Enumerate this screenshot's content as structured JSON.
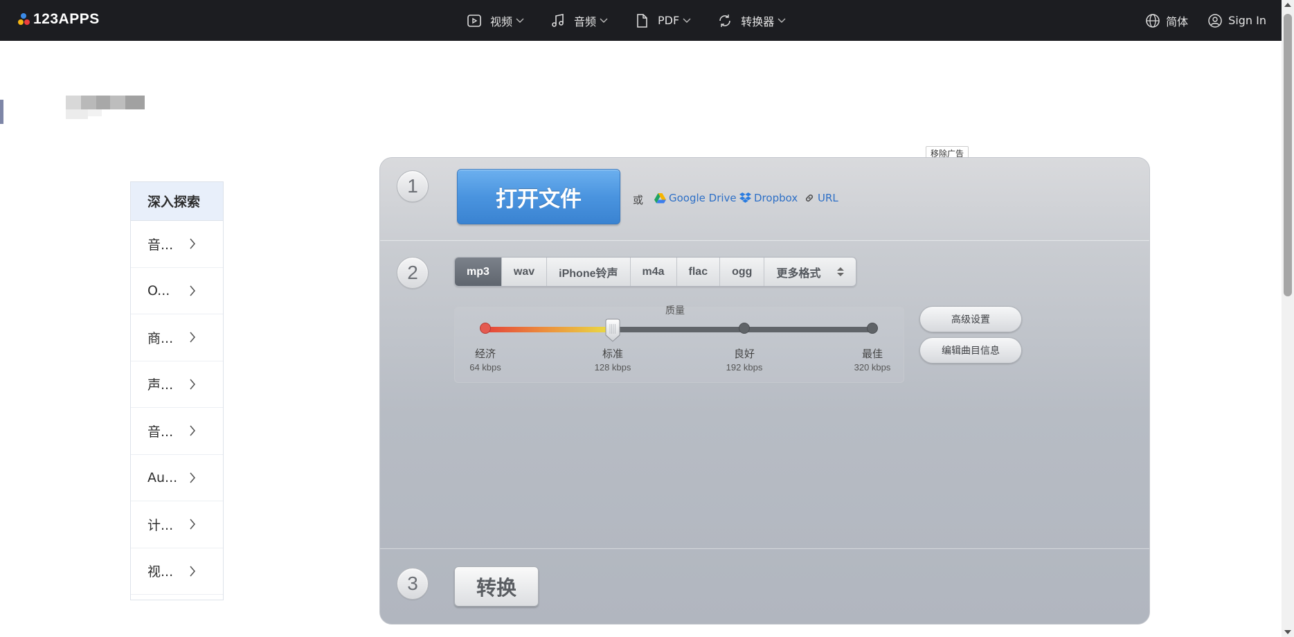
{
  "brand": {
    "name": "123APPS"
  },
  "nav": {
    "items": [
      {
        "label": "视频",
        "icon": "video-icon"
      },
      {
        "label": "音频",
        "icon": "music-note-icon"
      },
      {
        "label": "PDF",
        "icon": "document-icon"
      },
      {
        "label": "转换器",
        "icon": "convert-icon"
      }
    ],
    "language": "简体",
    "signin": "Sign In"
  },
  "sidebar": {
    "heading": "深入探索",
    "items": [
      {
        "label": "音..."
      },
      {
        "label": "O..."
      },
      {
        "label": "商..."
      },
      {
        "label": "声..."
      },
      {
        "label": "音..."
      },
      {
        "label": "Au..."
      },
      {
        "label": "计..."
      },
      {
        "label": "视..."
      }
    ]
  },
  "ad": {
    "remove_label": "移除广告"
  },
  "steps": {
    "one": "1",
    "two": "2",
    "three": "3"
  },
  "open": {
    "button_label": "打开文件",
    "or_text": "或",
    "google_drive": "Google Drive",
    "dropbox": "Dropbox",
    "url": "URL"
  },
  "formats": {
    "items": [
      "mp3",
      "wav",
      "iPhone铃声",
      "m4a",
      "flac",
      "ogg"
    ],
    "selected": "mp3",
    "more_label": "更多格式"
  },
  "quality": {
    "title": "质量",
    "selected_index": 1,
    "levels": [
      {
        "name": "经济",
        "bitrate": "64 kbps"
      },
      {
        "name": "标准",
        "bitrate": "128 kbps"
      },
      {
        "name": "良好",
        "bitrate": "192 kbps"
      },
      {
        "name": "最佳",
        "bitrate": "320 kbps"
      }
    ]
  },
  "buttons": {
    "advanced": "高级设置",
    "edit_info": "编辑曲目信息",
    "convert": "转换"
  },
  "colors": {
    "topbar": "#1c1d21",
    "accent_blue": "#4a94df",
    "link": "#2d6fc6"
  }
}
